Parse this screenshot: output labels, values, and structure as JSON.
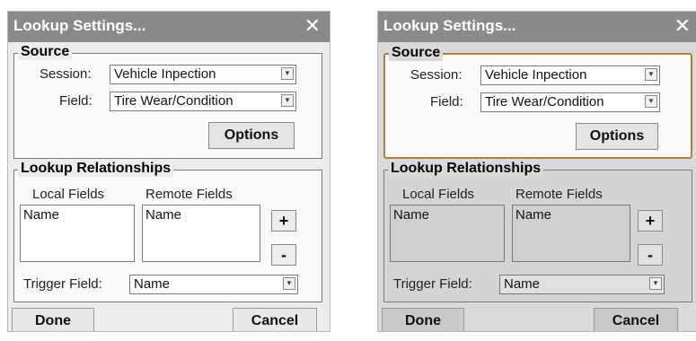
{
  "dialogs": [
    {
      "title": "Lookup Settings...",
      "close_glyph": "✕",
      "source": {
        "legend": "Source",
        "session_label": "Session:",
        "session_value": "Vehicle Inpection",
        "field_label": "Field:",
        "field_value": "Tire Wear/Condition",
        "options_label": "Options"
      },
      "lookup": {
        "legend": "Lookup Relationships",
        "local_fields_header": "Local Fields",
        "remote_fields_header": "Remote Fields",
        "local_fields_items": [
          "Name"
        ],
        "remote_fields_items": [
          "Name"
        ],
        "add_label": "+",
        "remove_label": "-",
        "trigger_label": "Trigger Field:",
        "trigger_value": "Name"
      },
      "done_label": "Done",
      "cancel_label": "Cancel"
    },
    {
      "title": "Lookup Settings...",
      "close_glyph": "✕",
      "source": {
        "legend": "Source",
        "session_label": "Session:",
        "session_value": "Vehicle Inpection",
        "field_label": "Field:",
        "field_value": "Tire Wear/Condition",
        "options_label": "Options"
      },
      "lookup": {
        "legend": "Lookup Relationships",
        "local_fields_header": "Local Fields",
        "remote_fields_header": "Remote Fields",
        "local_fields_items": [
          "Name"
        ],
        "remote_fields_items": [
          "Name"
        ],
        "add_label": "+",
        "remove_label": "-",
        "trigger_label": "Trigger Field:",
        "trigger_value": "Name"
      },
      "done_label": "Done",
      "cancel_label": "Cancel"
    }
  ],
  "colors": {
    "titlebar": "#8a8a8a",
    "highlight_border": "#b07f3e",
    "dialog_bg": "#ececec",
    "disabled_bg": "#d9d9d9"
  },
  "icons": {
    "dropdown": "chevron-down-icon",
    "close": "close-icon"
  }
}
